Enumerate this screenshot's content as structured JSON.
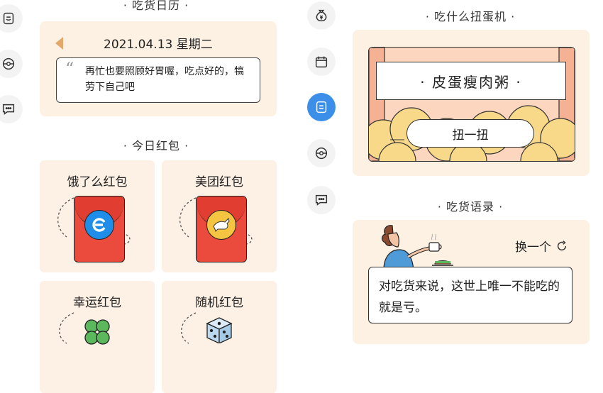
{
  "left_panel": {
    "calendar": {
      "title": "· 吃货日历 ·",
      "date": "2021.04.13 星期二",
      "quote": "再忙也要照顾好胃喔，吃点好的，犒劳下自己吧"
    },
    "red_packets": {
      "title": "· 今日红包 ·",
      "items": [
        {
          "label": "饿了么红包",
          "icon": "eleme-logo-icon"
        },
        {
          "label": "美团红包",
          "icon": "meituan-kangaroo-icon"
        },
        {
          "label": "幸运红包",
          "icon": "four-leaf-clover-icon"
        },
        {
          "label": "随机红包",
          "icon": "dice-icon"
        }
      ]
    }
  },
  "right_panel": {
    "gacha": {
      "title": "· 吃什么扭蛋机 ·",
      "result": "· 皮蛋瘦肉粥 ·",
      "spin_label": "扭一扭"
    },
    "quotes": {
      "title": "· 吃货语录 ·",
      "refresh_label": "换一个",
      "text": "对吃货来说，这世上唯一不能吃的就是亏。"
    }
  },
  "colors": {
    "card_bg": "#fdf1e3",
    "accent_blue": "#3b8fe8",
    "envelope_red": "#ea4b3d",
    "gacha_orange": "#f5b193",
    "ball_yellow": "#f8d889"
  }
}
